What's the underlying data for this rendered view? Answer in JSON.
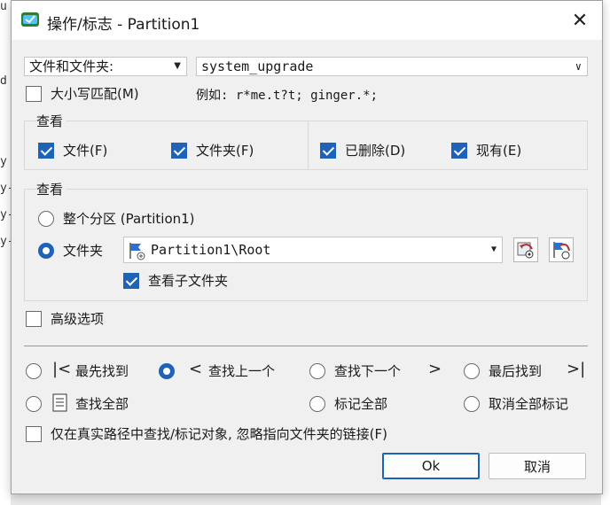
{
  "window": {
    "title": "操作/标志 - Partition1"
  },
  "search": {
    "scope_value": "文件和文件夹:",
    "pattern_value": "system_upgrade",
    "match_case_label": "大小写匹配(M)",
    "example_text": "例如: r*me.t?t; ginger.*;"
  },
  "view_types": {
    "title": "查看",
    "files_label": "文件(F)",
    "folders_label": "文件夹(F)",
    "deleted_label": "已删除(D)",
    "existing_label": "现有(E)"
  },
  "view_location": {
    "title": "查看",
    "whole_partition_label": "整个分区 (Partition1)",
    "folder_label": "文件夹",
    "folder_path": "Partition1\\Root",
    "subfolders_label": "查看子文件夹"
  },
  "advanced_label": "高级选项",
  "navigation": {
    "find_first": "最先找到",
    "find_prev": "查找上一个",
    "find_next": "查找下一个",
    "find_last": "最后找到",
    "find_all": "查找全部",
    "mark_all": "标记全部",
    "unmark_all": "取消全部标记"
  },
  "real_path_label": "仅在真实路径中查找/标记对象, 忽略指向文件夹的链接(F)",
  "buttons": {
    "ok": "Ok",
    "cancel": "取消"
  },
  "colors": {
    "accent": "#1f63b8"
  },
  "icons": {
    "title": "app-icon",
    "close": "close-icon",
    "folder": "partition-folder-icon",
    "browse_back": "folder-back-icon",
    "browse_up": "folder-up-icon",
    "find_all": "document-list-icon"
  }
}
